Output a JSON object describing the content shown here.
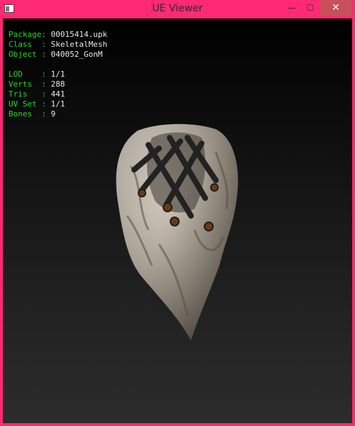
{
  "window": {
    "title": "UE Viewer"
  },
  "controls": {
    "minimize": "—",
    "maximize": "☐",
    "close": "✕"
  },
  "info": {
    "package": {
      "key": "Package: ",
      "value": "00015414.upk"
    },
    "class": {
      "key": "Class  : ",
      "value": "SkeletalMesh"
    },
    "object": {
      "key": "Object : ",
      "value": "040052_GonM"
    },
    "lod": {
      "key": "LOD    : ",
      "value": "1/1"
    },
    "verts": {
      "key": "Verts  : ",
      "value": "288"
    },
    "tris": {
      "key": "Tris   : ",
      "value": "441"
    },
    "uvset": {
      "key": "UV Set : ",
      "value": "1/1"
    },
    "bones": {
      "key": "Bones  : ",
      "value": "9"
    }
  },
  "colors": {
    "frame": "#ff2a73",
    "label": "#28d428",
    "value": "#e8e8e8"
  }
}
